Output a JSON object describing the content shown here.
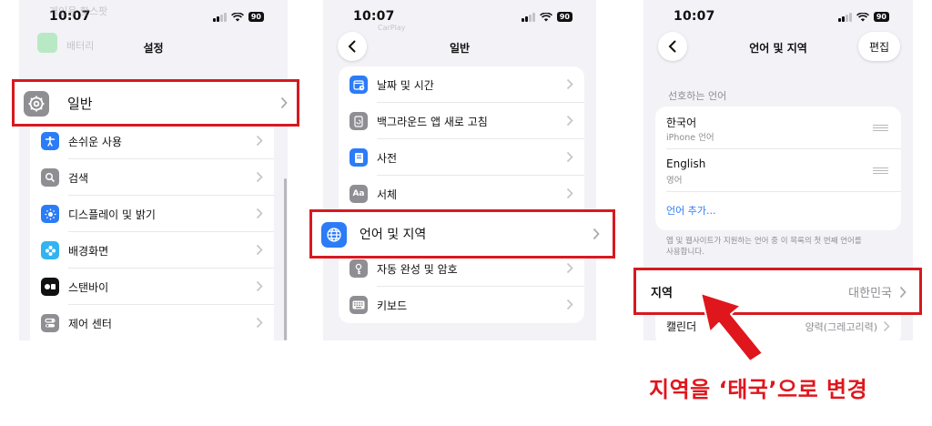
{
  "status": {
    "time": "10:07",
    "battery": "90"
  },
  "screen1": {
    "title": "설정",
    "faded_items": [
      "개인용 핫스팟",
      "배터리"
    ],
    "highlighted": {
      "label": "일반"
    },
    "items": [
      {
        "label": "손쉬운 사용",
        "icon": "accessibility-icon",
        "color": "#2b7cf6"
      },
      {
        "label": "검색",
        "icon": "search-icon",
        "color": "#8e8e93"
      },
      {
        "label": "디스플레이 및 밝기",
        "icon": "brightness-icon",
        "color": "#2b7cf6"
      },
      {
        "label": "배경화면",
        "icon": "wallpaper-icon",
        "color": "#33b4f0"
      },
      {
        "label": "스탠바이",
        "icon": "standby-icon",
        "color": "#111111"
      },
      {
        "label": "제어 센터",
        "icon": "control-center-icon",
        "color": "#8e8e93"
      }
    ]
  },
  "screen2": {
    "title": "일반",
    "faded_item": "CarPlay",
    "items_top": [
      {
        "label": "날짜 및 시간",
        "icon": "calendar-clock-icon",
        "color": "#2b7cf6"
      },
      {
        "label": "백그라운드 앱 새로 고침",
        "icon": "app-refresh-icon",
        "color": "#8e8e93"
      },
      {
        "label": "사전",
        "icon": "dictionary-icon",
        "color": "#2b7cf6"
      },
      {
        "label": "서체",
        "icon": "font-icon",
        "color": "#8e8e93"
      }
    ],
    "highlighted": {
      "label": "언어 및 지역"
    },
    "items_bottom": [
      {
        "label": "자동 완성 및 암호",
        "icon": "autofill-icon",
        "color": "#8e8e93"
      },
      {
        "label": "키보드",
        "icon": "keyboard-icon",
        "color": "#8e8e93"
      }
    ]
  },
  "screen3": {
    "title": "언어 및 지역",
    "edit_label": "편집",
    "section_header": "선호하는 언어",
    "languages": [
      {
        "name": "한국어",
        "sub": "iPhone 언어"
      },
      {
        "name": "English",
        "sub": "영어"
      }
    ],
    "add_language": "언어 추가...",
    "footnote_line1": "앱 및 웹사이트가 지원하는 언어 중 이 목록의 첫 번째 언어를",
    "footnote_line2": "사용합니다.",
    "region": {
      "label": "지역",
      "value": "대한민국"
    },
    "calendar": {
      "label": "캘린더",
      "value": "양력(그레고리력)"
    }
  },
  "caption": "지역을 ‘태국’으로 변경",
  "colors": {
    "highlight": "#d71920",
    "accent_blue": "#2b7cf6",
    "caption_red": "#e0161d"
  }
}
